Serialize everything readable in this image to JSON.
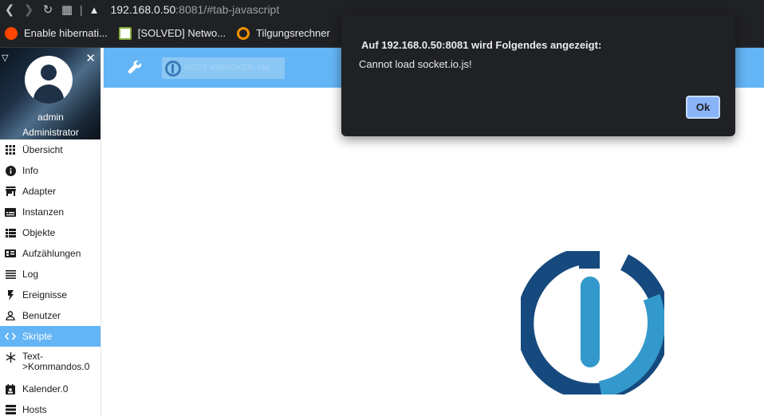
{
  "browser": {
    "url_host": "192.168.0.50",
    "url_rest": ":8081/#tab-javascript",
    "bookmarks": [
      {
        "label": "Enable hibernati..."
      },
      {
        "label": "[SOLVED] Netwo..."
      },
      {
        "label": "Tilgungsrechner"
      }
    ]
  },
  "sidebar": {
    "user_name": "admin",
    "user_role": "Administrator",
    "items": [
      {
        "label": "Übersicht",
        "icon": "apps-grid-icon"
      },
      {
        "label": "Info",
        "icon": "info-icon"
      },
      {
        "label": "Adapter",
        "icon": "store-icon"
      },
      {
        "label": "Instanzen",
        "icon": "instances-icon"
      },
      {
        "label": "Objekte",
        "icon": "list-icon"
      },
      {
        "label": "Aufzählungen",
        "icon": "enum-icon"
      },
      {
        "label": "Log",
        "icon": "log-lines-icon"
      },
      {
        "label": "Ereignisse",
        "icon": "flash-icon"
      },
      {
        "label": "Benutzer",
        "icon": "user-icon"
      },
      {
        "label": "Skripte",
        "icon": "code-icon",
        "active": true
      },
      {
        "label": "Text->Kommandos.0",
        "icon": "snowflake-icon"
      },
      {
        "label": "Kalender.0",
        "icon": "calendar-icon"
      },
      {
        "label": "Hosts",
        "icon": "hosts-icon"
      }
    ]
  },
  "topbar": {
    "host_label": "HOST IOBROKER-VM"
  },
  "dialog": {
    "title": "Auf 192.168.0.50:8081 wird Folgendes angezeigt:",
    "message": "Cannot load socket.io.js!",
    "ok_label": "Ok"
  },
  "colors": {
    "accent": "#64b5f6",
    "logo_dark": "#164a7e",
    "logo_light": "#3399cc"
  }
}
